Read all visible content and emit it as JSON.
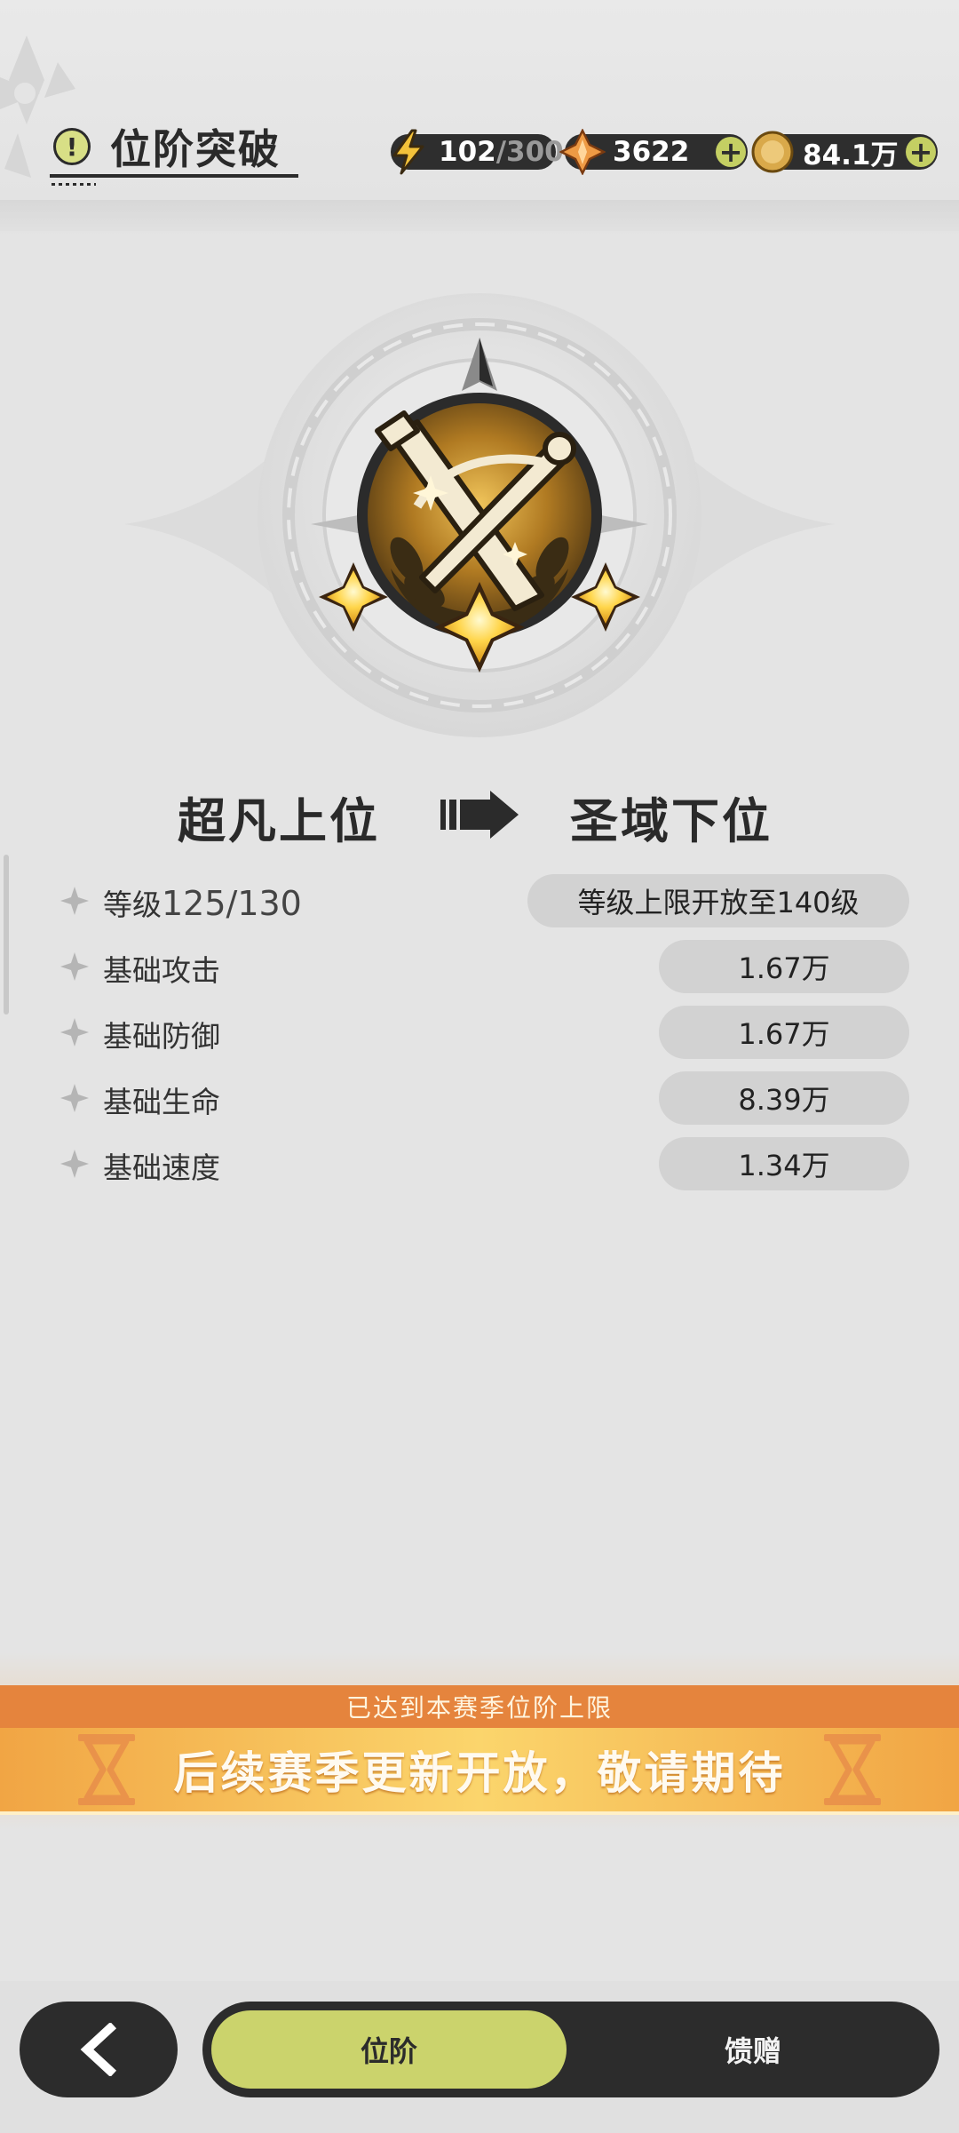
{
  "header": {
    "title": "位阶突破",
    "info_icon_text": "!"
  },
  "resources": {
    "energy": {
      "current": "102",
      "separator": "/",
      "max": "300"
    },
    "gems": "3622",
    "coins": "84.1万",
    "plus_glyph": "+"
  },
  "emblem": {
    "stars": 3
  },
  "rank": {
    "from": "超凡上位",
    "to": "圣域下位"
  },
  "stats": [
    {
      "label": "等级",
      "value": "125/130",
      "pill": "等级上限开放至140级"
    },
    {
      "label": "基础攻击",
      "pill": "1.67万"
    },
    {
      "label": "基础防御",
      "pill": "1.67万"
    },
    {
      "label": "基础生命",
      "pill": "8.39万"
    },
    {
      "label": "基础速度",
      "pill": "1.34万"
    }
  ],
  "banner": {
    "top": "已达到本赛季位阶上限",
    "main": "后续赛季更新开放，敬请期待"
  },
  "nav": {
    "tab_active": "位阶",
    "tab_other": "馈赠"
  },
  "colors": {
    "accent": "#cbd36c",
    "banner_orange": "#e5843d",
    "banner_gold": "#fbd56c",
    "dark": "#2c2c2c"
  }
}
